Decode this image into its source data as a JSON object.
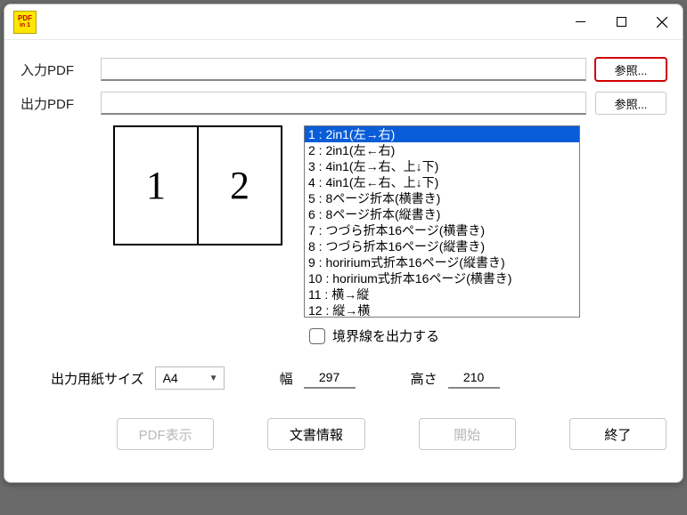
{
  "app_icon": {
    "line1": "PDF",
    "line2": "in 1"
  },
  "inputs": {
    "input_pdf_label": "入力PDF",
    "input_pdf_value": "",
    "input_browse": "参照...",
    "output_pdf_label": "出力PDF",
    "output_pdf_value": "",
    "output_browse": "参照..."
  },
  "preview_cells": [
    "1",
    "2"
  ],
  "layout_options": [
    "1 : 2in1(左→右)",
    "2 : 2in1(左←右)",
    "3 : 4in1(左→右、上↓下)",
    "4 : 4in1(左←右、上↓下)",
    "5 : 8ページ折本(横書き)",
    "6 : 8ページ折本(縦書き)",
    "7 : つづら折本16ページ(横書き)",
    "8 : つづら折本16ページ(縦書き)",
    "9 : horirium式折本16ページ(縦書き)",
    "10 : horirium式折本16ページ(横書き)",
    "11 : 横→縦",
    "12 : 縦→横"
  ],
  "selected_index": 0,
  "border_checkbox_label": "境界線を出力する",
  "paper": {
    "label": "出力用紙サイズ",
    "value": "A4",
    "width_label": "幅",
    "width_value": "297",
    "height_label": "高さ",
    "height_value": "210"
  },
  "buttons": {
    "view": "PDF表示",
    "info": "文書情報",
    "start": "開始",
    "exit": "終了"
  }
}
